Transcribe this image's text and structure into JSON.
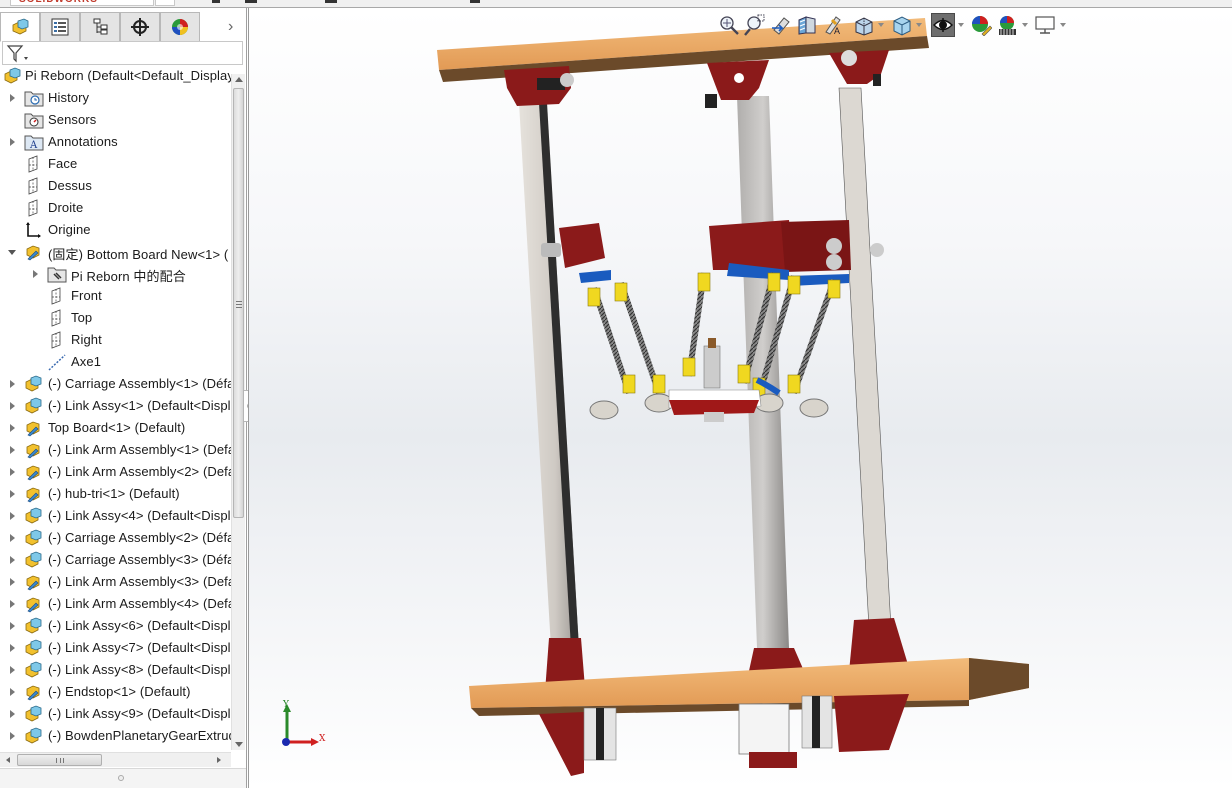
{
  "app": {
    "logo_text": "SOLIDWORKS"
  },
  "panel": {
    "tabs": [
      {
        "name": "featuremanager",
        "icon": "featuremanager-tree-icon",
        "active": true
      },
      {
        "name": "propertymanager",
        "icon": "property-manager-icon",
        "active": false
      },
      {
        "name": "configurationmanager",
        "icon": "configuration-manager-icon",
        "active": false
      },
      {
        "name": "dimxpertmanager",
        "icon": "dimxpert-manager-icon",
        "active": false
      },
      {
        "name": "displaymanager",
        "icon": "display-manager-icon",
        "active": false
      }
    ],
    "more_label": "›",
    "filter_icon": "filter-icon"
  },
  "tree": {
    "root": {
      "label": "Pi Reborn  (Default<Default_Display",
      "icon": "assembly-icon"
    },
    "items": [
      {
        "label": "History",
        "icon": "history-folder-icon",
        "indent": 0,
        "expander": "closed"
      },
      {
        "label": "Sensors",
        "icon": "sensors-folder-icon",
        "indent": 0,
        "expander": "none"
      },
      {
        "label": "Annotations",
        "icon": "annotations-folder-icon",
        "indent": 0,
        "expander": "closed"
      },
      {
        "label": "Face",
        "icon": "plane-icon",
        "indent": 0,
        "expander": "none"
      },
      {
        "label": "Dessus",
        "icon": "plane-icon",
        "indent": 0,
        "expander": "none"
      },
      {
        "label": "Droite",
        "icon": "plane-icon",
        "indent": 0,
        "expander": "none"
      },
      {
        "label": "Origine",
        "icon": "origin-icon",
        "indent": 0,
        "expander": "none"
      },
      {
        "label": "(固定) Bottom Board New<1> (",
        "icon": "part-icon",
        "indent": 0,
        "expander": "open"
      },
      {
        "label": "Pi Reborn 中的配合",
        "icon": "mates-folder-icon",
        "indent": 1,
        "expander": "closed"
      },
      {
        "label": "Front",
        "icon": "plane-icon",
        "indent": 1,
        "expander": "none"
      },
      {
        "label": "Top",
        "icon": "plane-icon",
        "indent": 1,
        "expander": "none"
      },
      {
        "label": "Right",
        "icon": "plane-icon",
        "indent": 1,
        "expander": "none"
      },
      {
        "label": "Axe1",
        "icon": "axis-icon",
        "indent": 1,
        "expander": "none"
      },
      {
        "label": "(-) Carriage Assembly<1> (Défa",
        "icon": "subassembly-icon",
        "indent": 0,
        "expander": "closed"
      },
      {
        "label": "(-) Link Assy<1> (Default<Displ",
        "icon": "subassembly-icon",
        "indent": 0,
        "expander": "closed"
      },
      {
        "label": "Top Board<1> (Default)",
        "icon": "part-icon",
        "indent": 0,
        "expander": "closed"
      },
      {
        "label": "(-) Link Arm Assembly<1> (Defa",
        "icon": "part-icon",
        "indent": 0,
        "expander": "closed"
      },
      {
        "label": "(-) Link Arm Assembly<2> (Defa",
        "icon": "part-icon",
        "indent": 0,
        "expander": "closed"
      },
      {
        "label": "(-) hub-tri<1> (Default)",
        "icon": "part-icon",
        "indent": 0,
        "expander": "closed"
      },
      {
        "label": "(-) Link Assy<4> (Default<Displ",
        "icon": "subassembly-icon",
        "indent": 0,
        "expander": "closed"
      },
      {
        "label": "(-) Carriage Assembly<2> (Défa",
        "icon": "subassembly-icon",
        "indent": 0,
        "expander": "closed"
      },
      {
        "label": "(-) Carriage Assembly<3> (Défa",
        "icon": "subassembly-icon",
        "indent": 0,
        "expander": "closed"
      },
      {
        "label": "(-) Link Arm Assembly<3> (Defa",
        "icon": "part-icon",
        "indent": 0,
        "expander": "closed"
      },
      {
        "label": "(-) Link Arm Assembly<4> (Defa",
        "icon": "part-icon",
        "indent": 0,
        "expander": "closed"
      },
      {
        "label": "(-) Link Assy<6> (Default<Displ",
        "icon": "subassembly-icon",
        "indent": 0,
        "expander": "closed"
      },
      {
        "label": "(-) Link Assy<7> (Default<Displ",
        "icon": "subassembly-icon",
        "indent": 0,
        "expander": "closed"
      },
      {
        "label": "(-) Link Assy<8> (Default<Displ",
        "icon": "subassembly-icon",
        "indent": 0,
        "expander": "closed"
      },
      {
        "label": "(-) Endstop<1> (Default)",
        "icon": "part-icon",
        "indent": 0,
        "expander": "closed"
      },
      {
        "label": "(-) Link Assy<9> (Default<Displ",
        "icon": "subassembly-icon",
        "indent": 0,
        "expander": "closed"
      },
      {
        "label": "(-) BowdenPlanetaryGearExtrud",
        "icon": "subassembly-icon",
        "indent": 0,
        "expander": "closed"
      }
    ]
  },
  "hud_toolbar": {
    "buttons": [
      {
        "name": "zoom-to-fit",
        "icon": "zoom-to-fit-icon"
      },
      {
        "name": "zoom-to-area",
        "icon": "zoom-to-area-icon"
      },
      {
        "name": "previous-view",
        "icon": "previous-view-icon"
      },
      {
        "name": "section-view",
        "icon": "section-view-icon"
      },
      {
        "name": "dynamic-annotation-views",
        "icon": "dynamic-annotation-icon"
      },
      {
        "name": "view-orientation",
        "icon": "view-orientation-icon",
        "has_dropdown": true
      },
      {
        "name": "display-style",
        "icon": "display-style-icon",
        "has_dropdown": true
      },
      {
        "name": "hide-show-items",
        "icon": "hide-show-eye-icon",
        "has_dropdown": true,
        "pressed": true
      },
      {
        "name": "edit-appearance",
        "icon": "edit-appearance-icon"
      },
      {
        "name": "apply-scene",
        "icon": "apply-scene-icon",
        "has_dropdown": true
      },
      {
        "name": "view-settings",
        "icon": "view-settings-monitor-icon",
        "has_dropdown": true
      }
    ]
  },
  "triad": {
    "x_label": "X",
    "y_label": "Y"
  },
  "model": {
    "name": "Pi Reborn",
    "colors": {
      "wood": "#e8a865",
      "wood_dark": "#6b4a2a",
      "bracket": "#8b1a1a",
      "rail": "#d8d4cf",
      "arm_yellow": "#f0d820",
      "joint_blue": "#1a5bbf"
    }
  }
}
